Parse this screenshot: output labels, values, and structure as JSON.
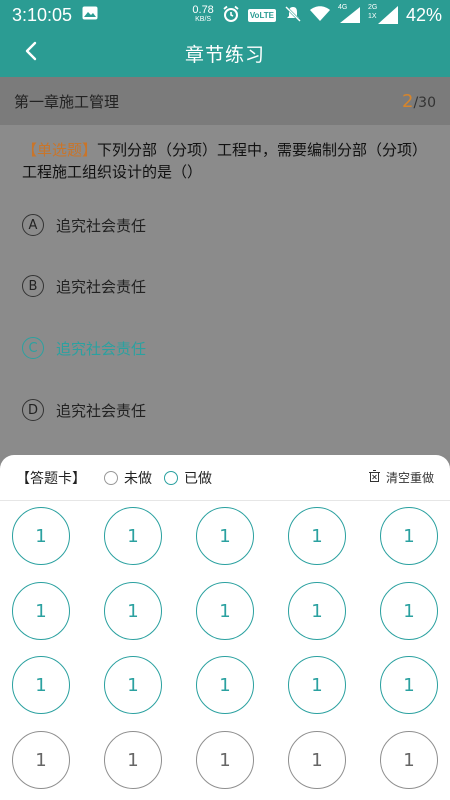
{
  "status": {
    "time": "3:10:05",
    "speed": "0.78",
    "speed_unit": "KB/S",
    "volte": "VoLTE",
    "net1": "4G",
    "net2": "2G",
    "net3": "1X",
    "battery": "42%"
  },
  "nav": {
    "title": "章节练习"
  },
  "chapter": {
    "name": "第一章施工管理",
    "current": "2",
    "total": "/30"
  },
  "question": {
    "type_label": "【单选题】",
    "text": "下列分部（分项）工程中，需要编制分部（分项）工程施工组织设计的是（）"
  },
  "options": [
    {
      "letter": "A",
      "text": "追究社会责任"
    },
    {
      "letter": "B",
      "text": "追究社会责任"
    },
    {
      "letter": "C",
      "text": "追究社会责任"
    },
    {
      "letter": "D",
      "text": "追究社会责任"
    }
  ],
  "sheet": {
    "title": "【答题卡】",
    "undone_label": "未做",
    "done_label": "已做",
    "clear_label": "清空重做",
    "cells": [
      {
        "num": "1",
        "state": "done"
      },
      {
        "num": "1",
        "state": "done"
      },
      {
        "num": "1",
        "state": "done"
      },
      {
        "num": "1",
        "state": "done"
      },
      {
        "num": "1",
        "state": "done"
      },
      {
        "num": "1",
        "state": "done"
      },
      {
        "num": "1",
        "state": "done"
      },
      {
        "num": "1",
        "state": "done"
      },
      {
        "num": "1",
        "state": "done"
      },
      {
        "num": "1",
        "state": "done"
      },
      {
        "num": "1",
        "state": "done"
      },
      {
        "num": "1",
        "state": "done"
      },
      {
        "num": "1",
        "state": "done"
      },
      {
        "num": "1",
        "state": "done"
      },
      {
        "num": "1",
        "state": "done"
      },
      {
        "num": "1",
        "state": "undone"
      },
      {
        "num": "1",
        "state": "undone"
      },
      {
        "num": "1",
        "state": "undone"
      },
      {
        "num": "1",
        "state": "undone"
      },
      {
        "num": "1",
        "state": "undone"
      }
    ]
  },
  "colors": {
    "brand": "#2b9c93",
    "accent": "#2ba1a0",
    "orange": "#d7852b"
  },
  "icons": {
    "back": "back-arrow-icon",
    "clear": "trash-icon"
  }
}
